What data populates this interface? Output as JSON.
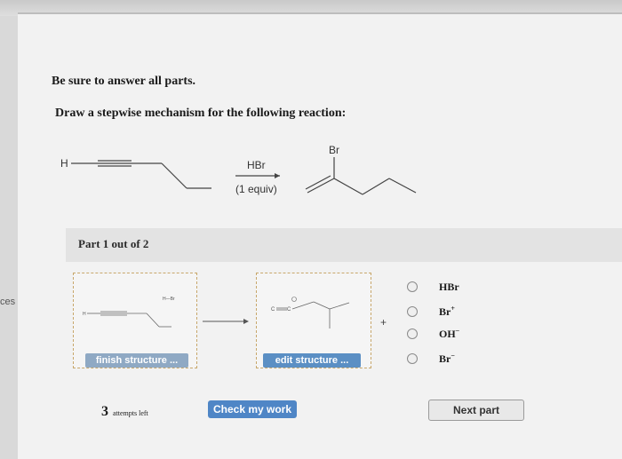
{
  "side_tab": {
    "label": "ces"
  },
  "instructions": {
    "line1": "Be sure to answer all parts.",
    "line2": "Draw a stepwise mechanism for the following reaction:"
  },
  "reaction": {
    "reactant_h": "H",
    "reagent": "HBr",
    "equiv": "(1 equiv)",
    "product_br": "Br"
  },
  "part": {
    "label": "Part 1 out of 2"
  },
  "workspace": {
    "box1_h": "H",
    "box1_hbr": "H—Br",
    "box2_c1": "C",
    "box2_c2": "C",
    "finish_label": "finish structure ...",
    "edit_label": "edit structure ...",
    "plus": "+"
  },
  "options": [
    {
      "main": "HBr",
      "sup": ""
    },
    {
      "main": "Br",
      "sup": "+"
    },
    {
      "main": "OH",
      "sup": "−"
    },
    {
      "main": "Br",
      "sup": "−"
    }
  ],
  "footer": {
    "attempts_num": "3",
    "attempts_text": "attempts left",
    "check_label": "Check my work",
    "next_label": "Next part"
  }
}
